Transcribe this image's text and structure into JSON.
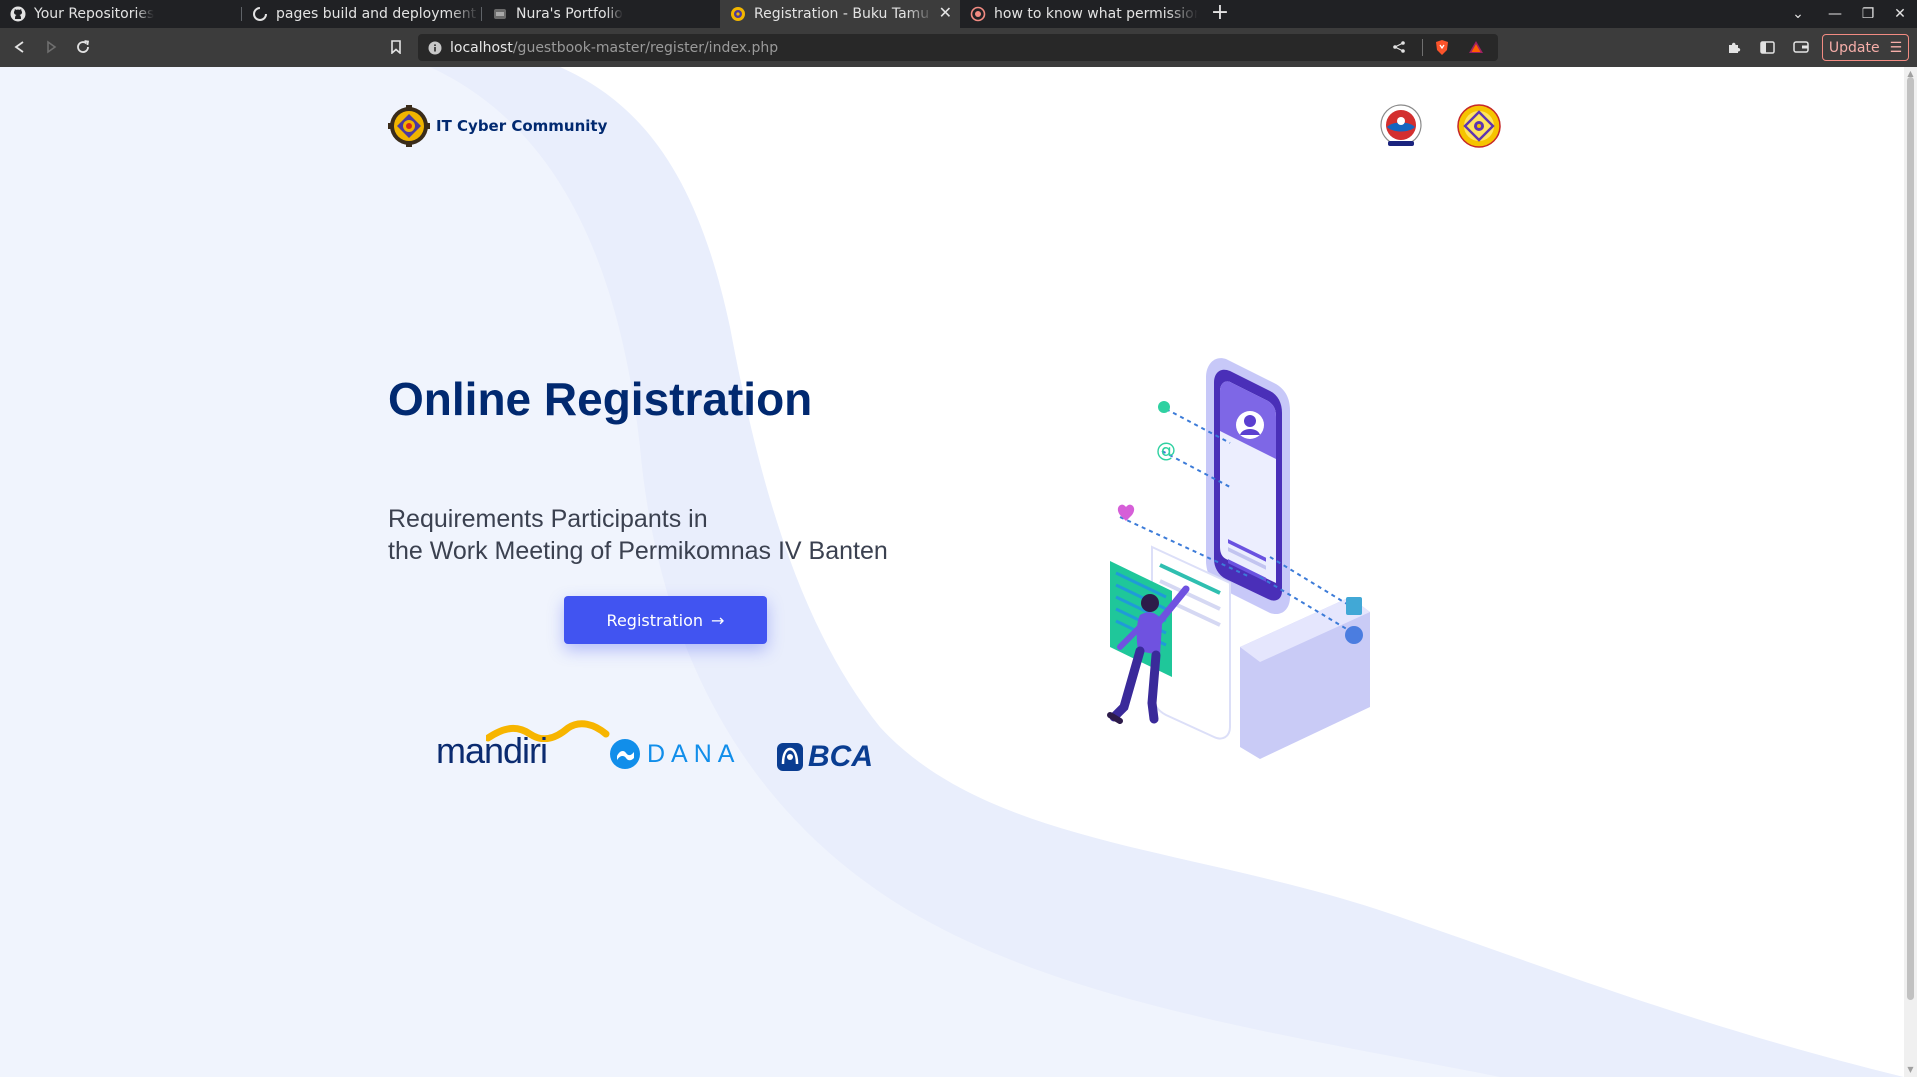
{
  "browser": {
    "tabs": [
      {
        "title": "Your Repositories",
        "active": false
      },
      {
        "title": "pages build and deployment · N",
        "active": false
      },
      {
        "title": "Nura's Portfolio",
        "active": false
      },
      {
        "title": "Registration - Buku Tamu ITC",
        "active": true
      },
      {
        "title": "how to know what permissions",
        "active": false
      }
    ],
    "url_host": "localhost",
    "url_path": "/guestbook-master/register/index.php",
    "update_label": "Update"
  },
  "page": {
    "brand_name": "IT Cyber Community",
    "hero_title": "Online Registration",
    "hero_subtitle_line1": "Requirements Participants in",
    "hero_subtitle_line2": "the Work Meeting of Permikomnas IV Banten",
    "register_button": "Registration",
    "register_arrow": "→",
    "sponsors": {
      "mandiri": "mandiri",
      "dana": "DANA",
      "bca": "BCA"
    }
  },
  "colors": {
    "primary": "#4154f1",
    "heading": "#012970",
    "background": "#f1f4fd"
  }
}
